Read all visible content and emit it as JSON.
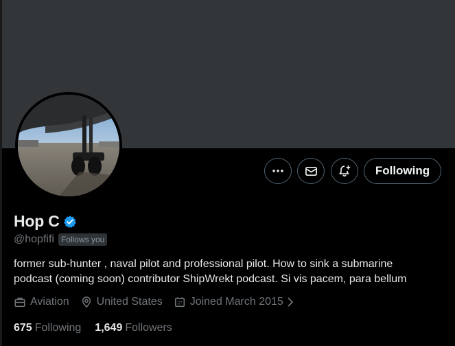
{
  "profile": {
    "display_name": "Hop C",
    "handle": "@hopfifi",
    "follows_you": "Follows you",
    "bio_lines": [
      "former sub-hunter , naval pilot and professional pilot. How to sink a submarine",
      "podcast (coming soon) contributor ShipWrekt podcast. Si vis pacem, para bellum"
    ],
    "category": "Aviation",
    "location": "United States",
    "joined": "Joined March 2015",
    "following_count": "675",
    "following_label": "Following",
    "followers_count": "1,649",
    "followers_label": "Followers"
  },
  "actions": {
    "following_button": "Following",
    "more_icon": "ellipsis-icon",
    "message_icon": "envelope-icon",
    "notify_icon": "bell-plus-icon"
  },
  "colors": {
    "background": "#000000",
    "banner": "#333639",
    "verified": "#1d9bf0",
    "secondary_text": "#71767b",
    "border": "#536471"
  }
}
